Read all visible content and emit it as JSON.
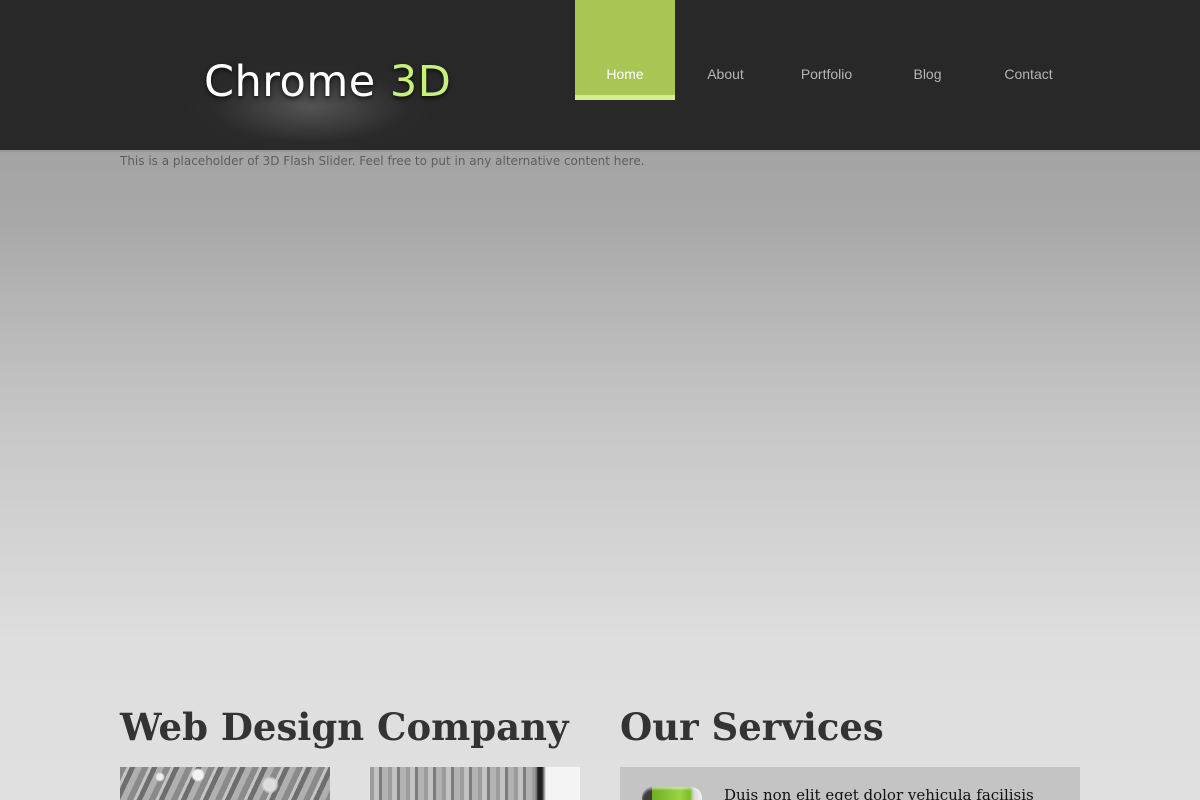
{
  "logo": {
    "main": "Chrome",
    "accent": "3D"
  },
  "nav": {
    "items": [
      {
        "label": "Home"
      },
      {
        "label": "About"
      },
      {
        "label": "Portfolio"
      },
      {
        "label": "Blog"
      },
      {
        "label": "Contact"
      }
    ],
    "active": "Home"
  },
  "slider": {
    "placeholder_text": "This is a placeholder of 3D Flash Slider. Feel free to put in any alternative content here."
  },
  "left_column": {
    "title": "Web Design Company"
  },
  "right_column": {
    "title": "Our Services",
    "first_service": {
      "text": "Duis non elit eget dolor vehicula facilisis"
    }
  },
  "colors": {
    "header_bg": "#282828",
    "nav_active_bg": "#a8c654",
    "logo_accent": "#c6f07a"
  }
}
